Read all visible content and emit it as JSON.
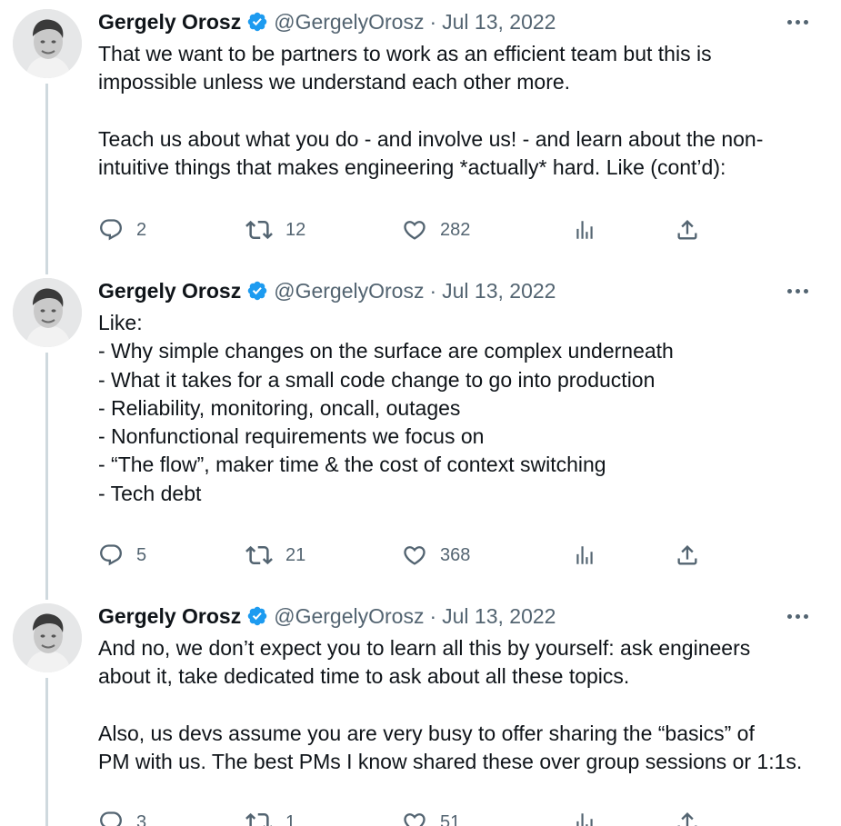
{
  "tweets": [
    {
      "author_name": "Gergely Orosz",
      "handle": "@GergelyOrosz",
      "separator": "·",
      "date": "Jul 13, 2022",
      "text": "That we want to be partners to work as an efficient team but this is\nimpossible unless we understand each other more.\n\nTeach us about what you do - and involve us! - and learn about the non-\nintuitive things that makes engineering *actually* hard. Like (cont’d):",
      "replies": "2",
      "retweets": "12",
      "likes": "282"
    },
    {
      "author_name": "Gergely Orosz",
      "handle": "@GergelyOrosz",
      "separator": "·",
      "date": "Jul 13, 2022",
      "text": "Like:\n- Why simple changes on the surface are complex underneath\n- What it takes for a small code change to go into production\n- Reliability, monitoring, oncall, outages\n- Nonfunctional requirements we focus on\n- “The flow”, maker time & the cost of context switching\n- Tech debt",
      "replies": "5",
      "retweets": "21",
      "likes": "368"
    },
    {
      "author_name": "Gergely Orosz",
      "handle": "@GergelyOrosz",
      "separator": "·",
      "date": "Jul 13, 2022",
      "text": "And no, we don’t expect you to learn all this by yourself: ask engineers\nabout it, take dedicated time to ask about all these topics.\n\nAlso, us devs assume you are very busy to offer sharing the “basics” of\nPM with us. The best PMs I know shared these over group sessions or 1:1s.",
      "replies": "3",
      "retweets": "1",
      "likes": "51"
    }
  ],
  "icons": {
    "verified": "verified-badge-icon",
    "more": "more-icon",
    "reply": "reply-icon",
    "retweet": "retweet-icon",
    "like": "like-icon",
    "views": "views-icon",
    "share": "share-icon"
  },
  "colors": {
    "verified": "#1d9bf0",
    "text_primary": "#0f1419",
    "text_secondary": "#536471",
    "thread_line": "#cfd9de"
  }
}
